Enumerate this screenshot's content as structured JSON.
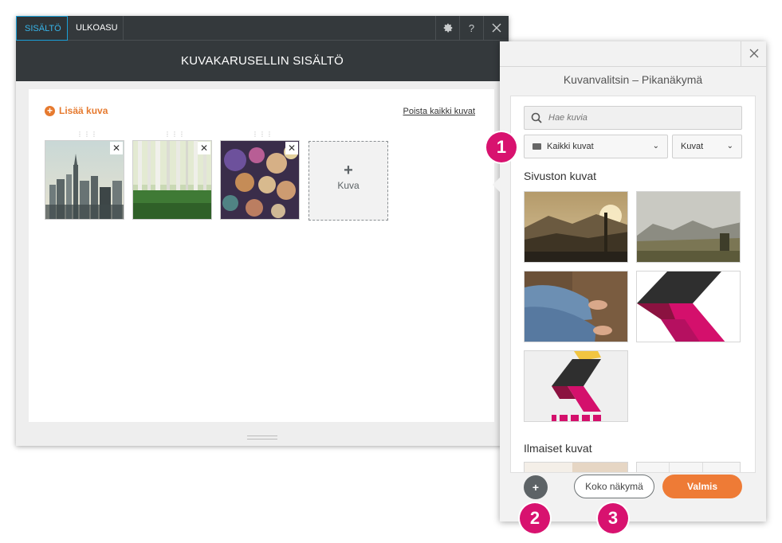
{
  "editor": {
    "tabs": [
      {
        "label": "SISÄLTÖ",
        "active": true
      },
      {
        "label": "ULKOASU",
        "active": false
      }
    ],
    "header_icons": [
      "gear-icon",
      "help-icon",
      "close-icon"
    ],
    "help_label": "?",
    "title": "KUVAKARUSELLIN SISÄLTÖ",
    "add_image_label": "Lisää kuva",
    "remove_all_label": "Poista kaikki kuvat",
    "thumbnails": [
      {
        "subject": "city skyline"
      },
      {
        "subject": "birch forest"
      },
      {
        "subject": "bokeh lights"
      }
    ],
    "add_tile_label": "Kuva"
  },
  "picker": {
    "title": "Kuvanvalitsin – Pikanäkymä",
    "search_placeholder": "Hae kuvia",
    "folder_select": "Kaikki kuvat",
    "type_select": "Kuvat",
    "section_site": "Sivuston kuvat",
    "section_free": "Ilmaiset kuvat",
    "full_view_label": "Koko näkymä",
    "done_label": "Valmis"
  },
  "badges": [
    "1",
    "2",
    "3"
  ],
  "colors": {
    "accent_orange": "#ee7b36",
    "badge_magenta": "#d8126f",
    "dark_header": "#34393c",
    "active_tab": "#37b5ea"
  }
}
